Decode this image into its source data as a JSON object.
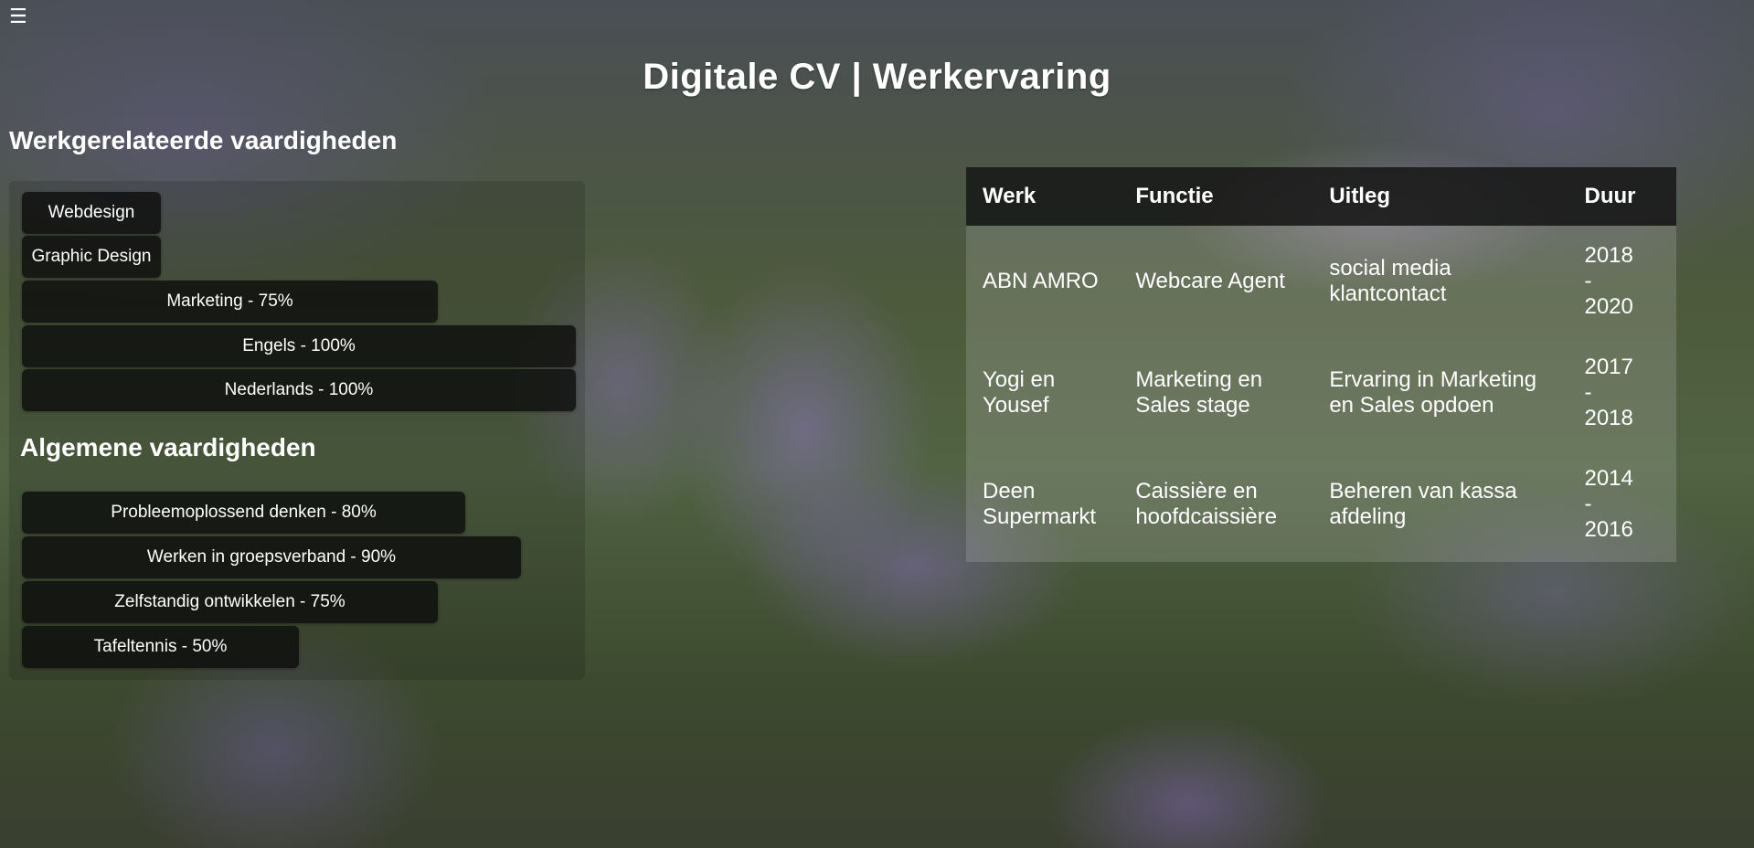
{
  "menu": {
    "icon": "hamburger-menu-icon",
    "glyph": "☰"
  },
  "header": {
    "title": "Digitale CV | Werkervaring"
  },
  "work_skills": {
    "title": "Werkgerelateerde vaardigheden",
    "items": [
      {
        "label": "Webdesign",
        "level": 0.25
      },
      {
        "label": "Graphic Design",
        "level": 0.25
      },
      {
        "label": "Marketing - 75%",
        "level": 0.75
      },
      {
        "label": "Engels - 100%",
        "level": 1.0
      },
      {
        "label": "Nederlands - 100%",
        "level": 1.0
      }
    ]
  },
  "general_skills": {
    "title": "Algemene vaardigheden",
    "items": [
      {
        "label": "Probleemoplossend denken - 80%",
        "level": 0.8
      },
      {
        "label": "Werken in groepsverband - 90%",
        "level": 0.9
      },
      {
        "label": "Zelfstandig ontwikkelen - 75%",
        "level": 0.75
      },
      {
        "label": "Tafeltennis - 50%",
        "level": 0.5
      }
    ]
  },
  "work_table": {
    "headers": {
      "werk": "Werk",
      "functie": "Functie",
      "uitleg": "Uitleg",
      "duur": "Duur"
    },
    "rows": [
      {
        "werk": "ABN AMRO",
        "functie": "Webcare Agent",
        "uitleg": "social media klantcontact",
        "duur_start": "2018",
        "duur_sep": "-",
        "duur_end": "2020"
      },
      {
        "werk": "Yogi en Yousef",
        "functie": "Marketing en Sales stage",
        "uitleg": "Ervaring in Marketing en Sales opdoen",
        "duur_start": "2017",
        "duur_sep": "-",
        "duur_end": "2018"
      },
      {
        "werk": "Deen Supermarkt",
        "functie": "Caissière en hoofdcaissière",
        "uitleg": "Beheren van kassa afdeling",
        "duur_start": "2014",
        "duur_sep": "-",
        "duur_end": "2016"
      }
    ]
  }
}
